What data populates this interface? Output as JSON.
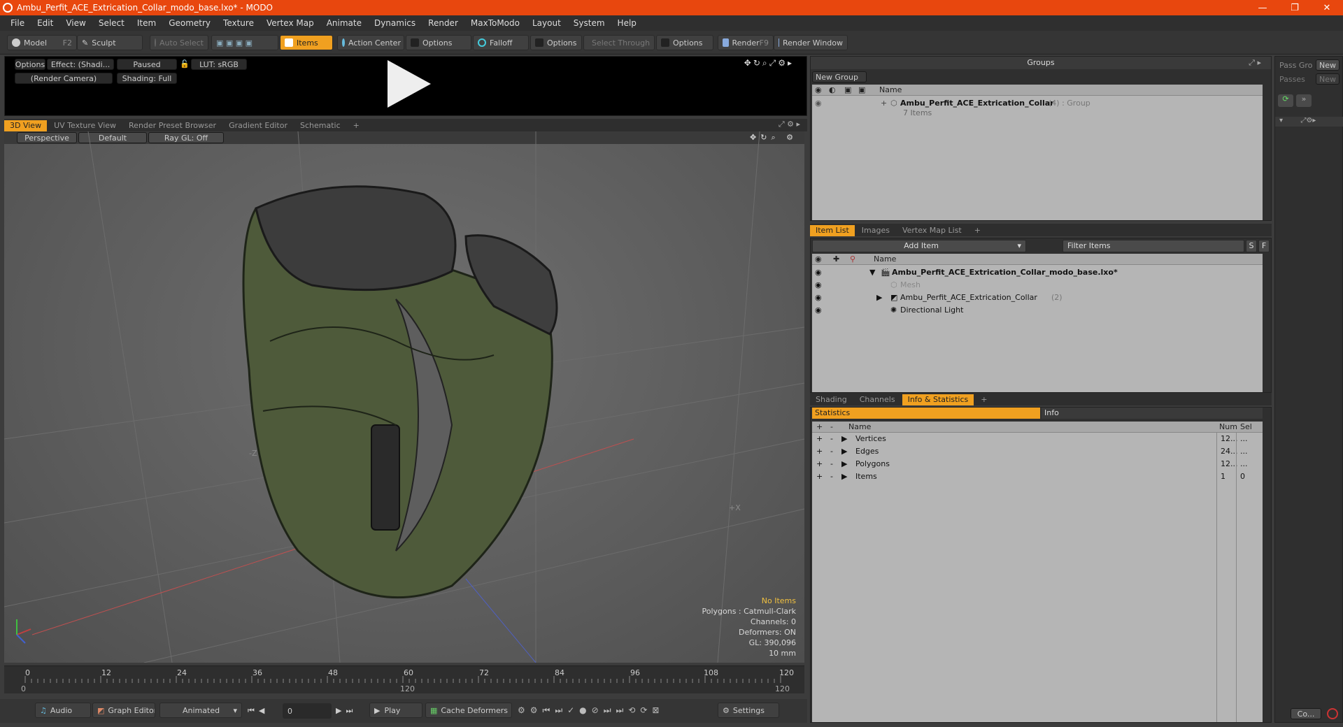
{
  "window": {
    "title": "Ambu_Perfit_ACE_Extrication_Collar_modo_base.lxo* - MODO"
  },
  "menu": [
    "File",
    "Edit",
    "View",
    "Select",
    "Item",
    "Geometry",
    "Texture",
    "Vertex Map",
    "Animate",
    "Dynamics",
    "Render",
    "MaxToModo",
    "Layout",
    "System",
    "Help"
  ],
  "toolbar": {
    "model": "Model",
    "model_key": "F2",
    "sculpt": "Sculpt",
    "auto_select": "Auto Select",
    "items": "Items",
    "action_center": "Action Center",
    "options1": "Options",
    "falloff": "Falloff",
    "options2": "Options",
    "select_through": "Select Through",
    "options3": "Options",
    "render": "Render",
    "render_key": "F9",
    "render_window": "Render Window"
  },
  "preview": {
    "options": "Options",
    "effect": "Effect: (Shadi...",
    "paused": "Paused",
    "lut": "LUT: sRGB",
    "camera": "(Render Camera)",
    "shading": "Shading: Full"
  },
  "view_tabs": [
    "3D View",
    "UV Texture View",
    "Render Preset Browser",
    "Gradient Editor",
    "Schematic"
  ],
  "viewport": {
    "perspective": "Perspective",
    "default": "Default",
    "raygl": "Ray GL: Off",
    "axis_z": "-Z",
    "axis_x": "+X"
  },
  "viewport_stats": {
    "no_items": "No Items",
    "polygons": "Polygons : Catmull-Clark",
    "channels": "Channels: 0",
    "deformers": "Deformers: ON",
    "gl": "GL: 390,096",
    "units": "10 mm"
  },
  "timeline": {
    "ticks": [
      "0",
      "12",
      "24",
      "36",
      "48",
      "60",
      "72",
      "84",
      "96",
      "108",
      "120"
    ],
    "sub_start": "0",
    "sub_mid": "120",
    "sub_end": "120"
  },
  "bottom": {
    "audio": "Audio",
    "graph_editor": "Graph Editor",
    "animated": "Animated",
    "frame": "0",
    "play": "Play",
    "cache": "Cache Deformers",
    "settings": "Settings"
  },
  "groups": {
    "title": "Groups",
    "new_group": "New Group",
    "col_name": "Name",
    "group_name": "Ambu_Perfit_ACE_Extrication_Collar",
    "group_suffix": "(4) : Group",
    "group_items": "7 Items"
  },
  "passes": {
    "pass_label": "Pass Gro",
    "new": "New",
    "passes_label": "Passes",
    "new2": "New",
    "co": "Co..."
  },
  "item_tabs": [
    "Item List",
    "Images",
    "Vertex Map List"
  ],
  "item_list": {
    "add_item": "Add Item",
    "filter": "Filter Items",
    "s": "S",
    "f": "F",
    "col_name": "Name",
    "rows": [
      {
        "label": "Ambu_Perfit_ACE_Extrication_Collar_modo_base.lxo*",
        "extra": ""
      },
      {
        "label": "Mesh",
        "extra": ""
      },
      {
        "label": "Ambu_Perfit_ACE_Extrication_Collar",
        "extra": "(2)"
      },
      {
        "label": "Directional Light",
        "extra": ""
      }
    ]
  },
  "info_tabs": [
    "Shading",
    "Channels",
    "Info & Statistics"
  ],
  "statistics": {
    "tab_stats": "Statistics",
    "tab_info": "Info",
    "col_name": "Name",
    "col_num": "Num",
    "col_sel": "Sel",
    "rows": [
      {
        "name": "Vertices",
        "num": "12...",
        "sel": "..."
      },
      {
        "name": "Edges",
        "num": "24...",
        "sel": "..."
      },
      {
        "name": "Polygons",
        "num": "12...",
        "sel": "..."
      },
      {
        "name": "Items",
        "num": "1",
        "sel": "0"
      }
    ]
  }
}
